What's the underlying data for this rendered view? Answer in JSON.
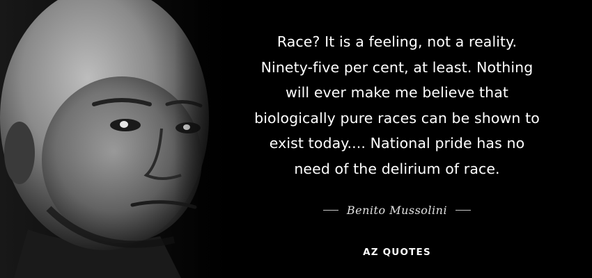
{
  "quote": {
    "lines": [
      "Race? It is a feeling, not a reality.",
      "Ninety-five per cent, at least. Nothing",
      "will ever make me believe that",
      "biologically pure races can be shown to",
      "exist today.... National pride has no",
      "need of the delirium of race."
    ]
  },
  "author": {
    "name": "Benito Mussolini"
  },
  "brand": {
    "logo_text": "AZ QUOTES"
  },
  "colors": {
    "background": "#000000",
    "text": "#ffffff"
  }
}
